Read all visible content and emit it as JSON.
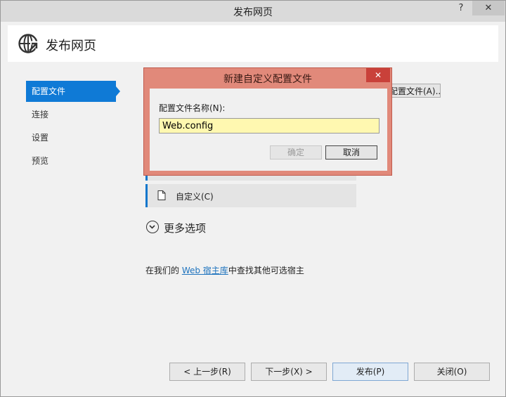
{
  "window": {
    "title": "发布网页",
    "help_glyph": "?",
    "close_glyph": "✕"
  },
  "header": {
    "title": "发布网页",
    "icon": "globe-publish-icon"
  },
  "nav": {
    "items": [
      {
        "label": "配置文件",
        "active": true
      },
      {
        "label": "连接",
        "active": false
      },
      {
        "label": "设置",
        "active": false
      },
      {
        "label": "预览",
        "active": false
      }
    ]
  },
  "main": {
    "profile_button_label": "配置文件(A)...",
    "custom_item_label": "自定义(C)",
    "more_options_label": "更多选项",
    "host_text_before": "在我们的 ",
    "host_link": "Web 宿主库",
    "host_text_after": "中查找其他可选宿主"
  },
  "footer": {
    "prev_label": "< 上一步(R)",
    "next_label": "下一步(X) >",
    "publish_label": "发布(P)",
    "close_label": "关闭(O)"
  },
  "dialog": {
    "title": "新建自定义配置文件",
    "close_glyph": "✕",
    "field_label": "配置文件名称(N):",
    "field_value": "Web.config",
    "ok_label": "确定",
    "cancel_label": "取消"
  },
  "colors": {
    "accent": "#0f7ad6",
    "dialog_frame": "#e1897a",
    "input_highlight": "#fff8b0"
  }
}
